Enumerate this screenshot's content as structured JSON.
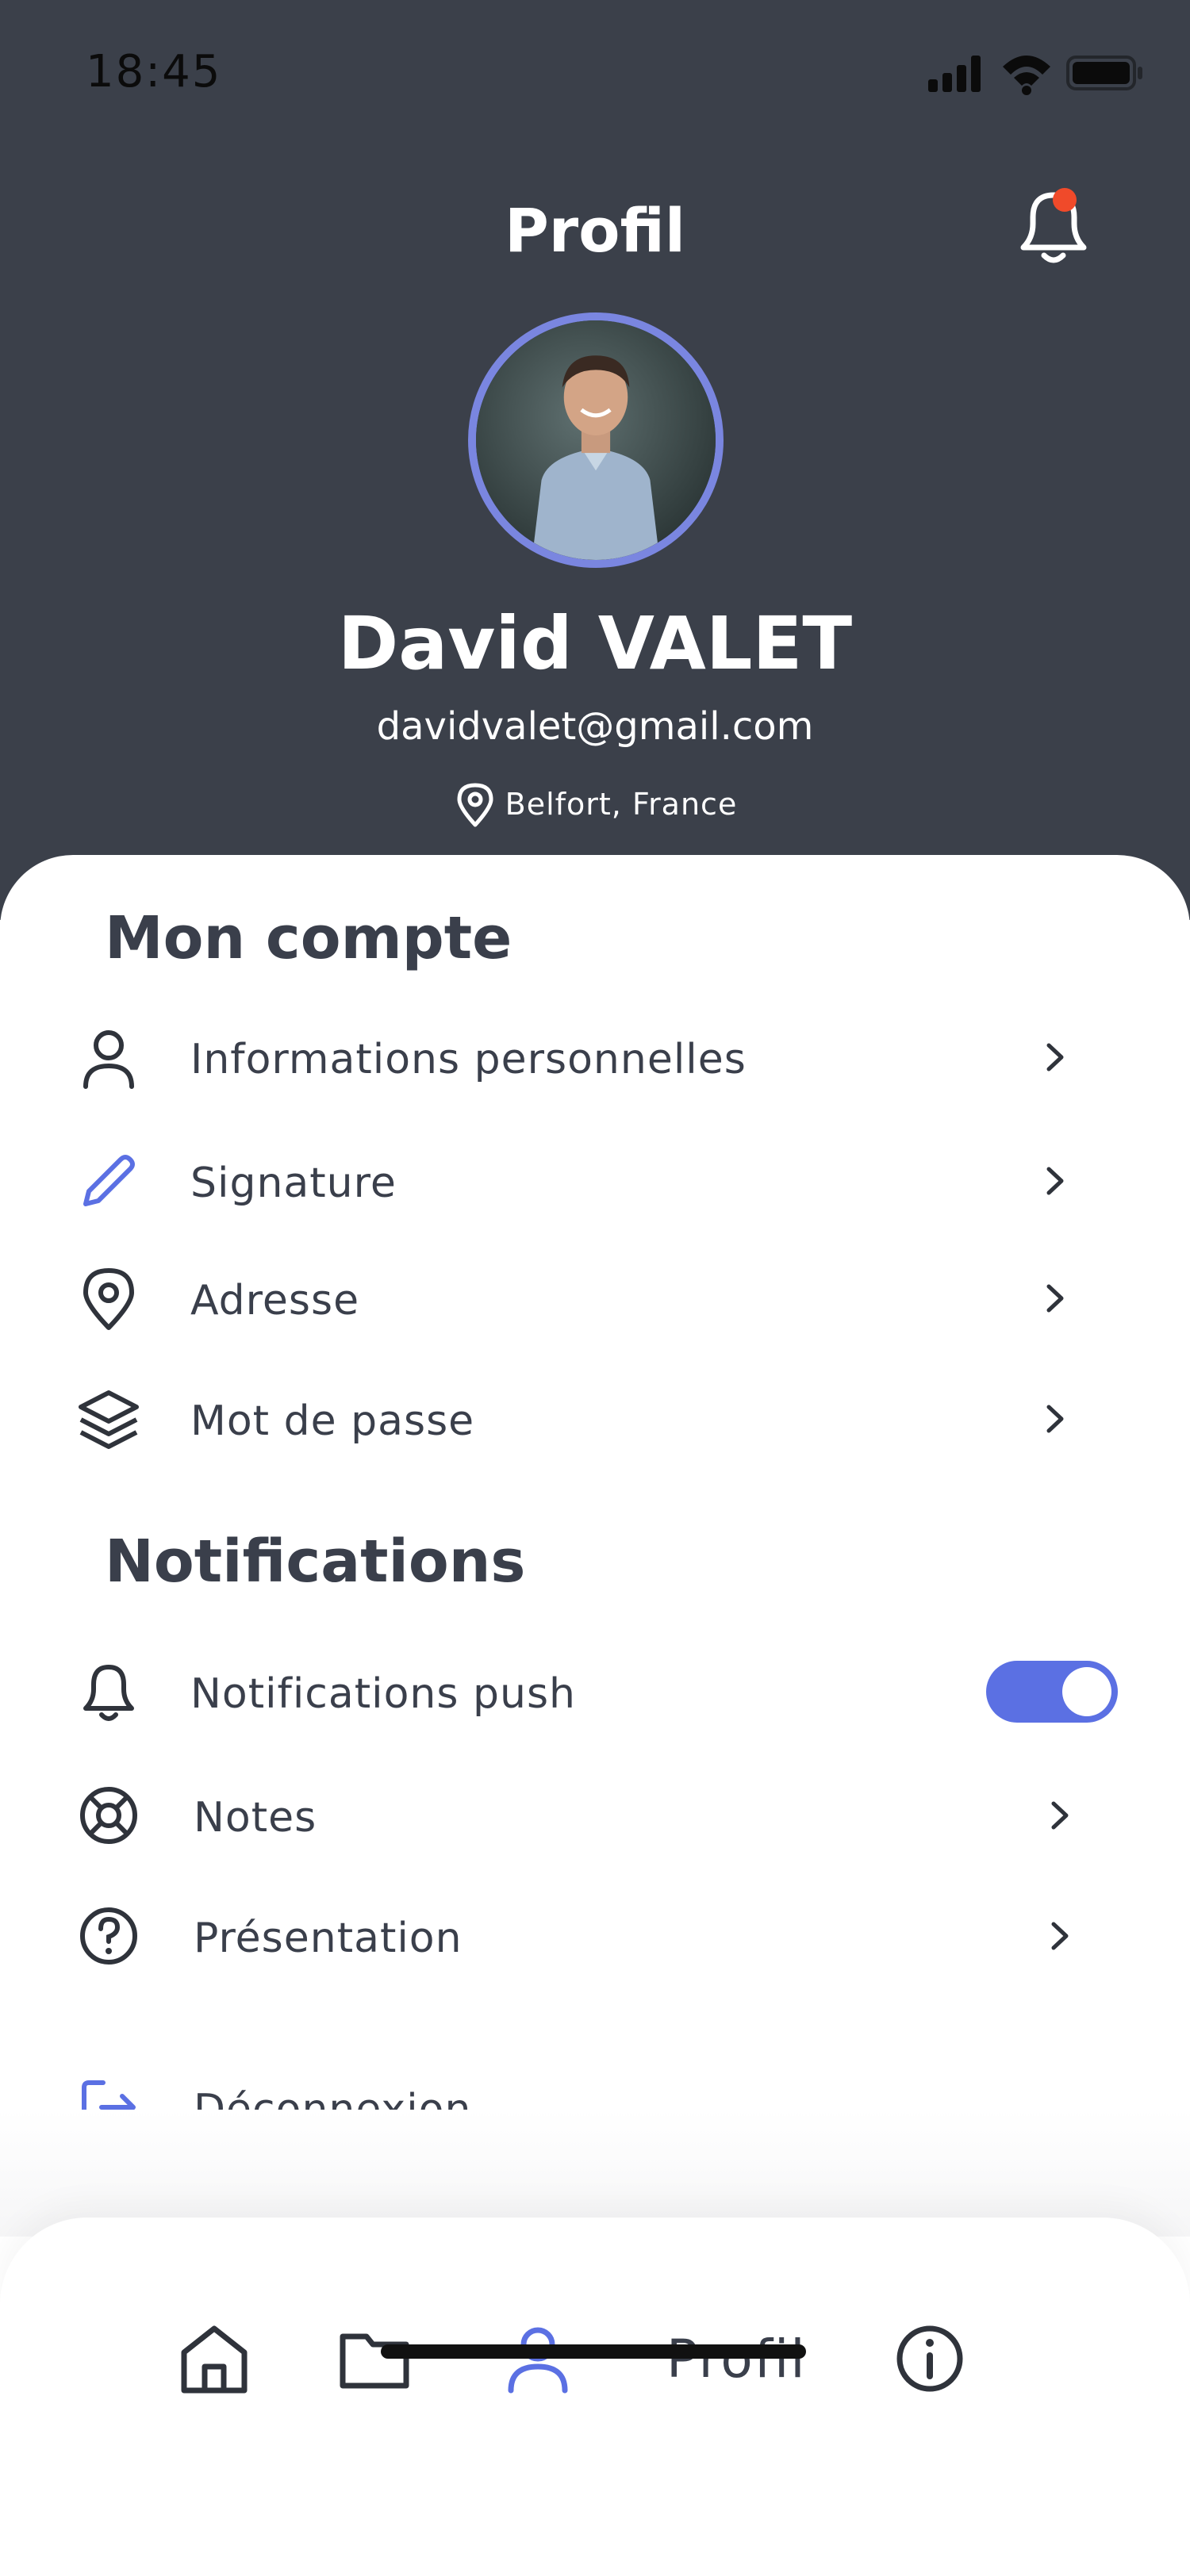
{
  "status_bar": {
    "time": "18:45"
  },
  "header": {
    "title": "Profil",
    "user": {
      "name": "David VALET",
      "email": "davidvalet@gmail.com",
      "location": "Belfort, France"
    },
    "notification_dot": true
  },
  "account": {
    "title": "Mon compte",
    "items": [
      {
        "label": "Informations personnelles",
        "icon": "user-icon"
      },
      {
        "label": "Signature",
        "icon": "pencil-icon"
      },
      {
        "label": "Adresse",
        "icon": "location-pin-icon"
      },
      {
        "label": "Mot de passe",
        "icon": "layers-icon"
      }
    ]
  },
  "notifications": {
    "title": "Notifications",
    "items": [
      {
        "label": "Notifications push",
        "icon": "bell-icon",
        "toggle_on": true
      },
      {
        "label": "Notes",
        "icon": "lifebuoy-icon"
      },
      {
        "label": "Présentation",
        "icon": "help-circle-icon"
      }
    ]
  },
  "logout": {
    "label": "Déconnexion",
    "icon": "logout-icon"
  },
  "bottom_nav": {
    "active_label": "Profil",
    "items": [
      "home-icon",
      "folder-icon",
      "profile-icon",
      "info-icon"
    ]
  },
  "colors": {
    "header_bg": "#3b404a",
    "accent": "#5b70e3",
    "text": "#3a3f4b",
    "badge": "#f04a2a"
  }
}
